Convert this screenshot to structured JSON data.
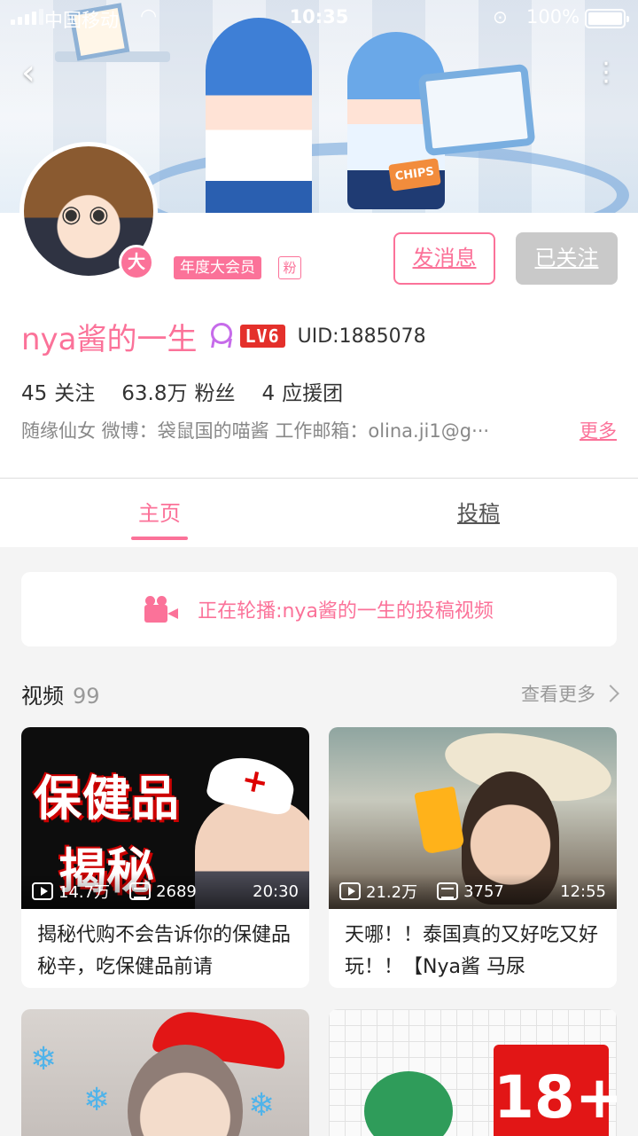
{
  "status": {
    "carrier": "中国移动",
    "time": "10:35",
    "battery": "100%"
  },
  "icons": {
    "back": "chevron-left-icon",
    "more": "more-vertical-icon",
    "wifi": "wifi-icon",
    "battery": "battery-icon",
    "playlist": "video-camera-icon",
    "plays": "play-icon",
    "danmaku": "danmaku-icon"
  },
  "profile": {
    "vip_badge": "大",
    "vip_tag": "年度大会员",
    "fan_tag": "粉",
    "message_button": "发消息",
    "follow_button": "已关注",
    "username": "nya酱的一生",
    "level": "LV6",
    "uid": "UID:1885078",
    "stats": {
      "following_num": "45",
      "following_label": "关注",
      "fans_num": "63.8万",
      "fans_label": "粉丝",
      "group_num": "4",
      "group_label": "应援团"
    },
    "bio": "随缘仙女 微博：袋鼠国的喵酱 工作邮箱：olina.ji1@g···",
    "bio_more": "更多"
  },
  "tabs": [
    {
      "label": "主页",
      "active": true
    },
    {
      "label": "投稿",
      "active": false
    }
  ],
  "playlist": {
    "text": "正在轮播:nya酱的一生的投稿视频"
  },
  "videos_section": {
    "title": "视频",
    "count": "99",
    "more": "查看更多"
  },
  "videos": [
    {
      "thumb_text1": "保健品",
      "thumb_text2": "揭秘",
      "plays": "14.7万",
      "danmaku": "2689",
      "duration": "20:30",
      "title": "揭秘代购不会告诉你的保健品秘辛，吃保健品前请"
    },
    {
      "plays": "21.2万",
      "danmaku": "3757",
      "duration": "12:55",
      "title": "天哪！！泰国真的又好吃又好玩！！【Nya酱 马尿"
    },
    {
      "flake": "❄"
    },
    {
      "thumb_text": "18+"
    }
  ],
  "colors": {
    "accent": "#fb7299",
    "level_red": "#e4302b",
    "medal_purple": "#c66bea",
    "followed_gray": "#c9c9c9"
  }
}
